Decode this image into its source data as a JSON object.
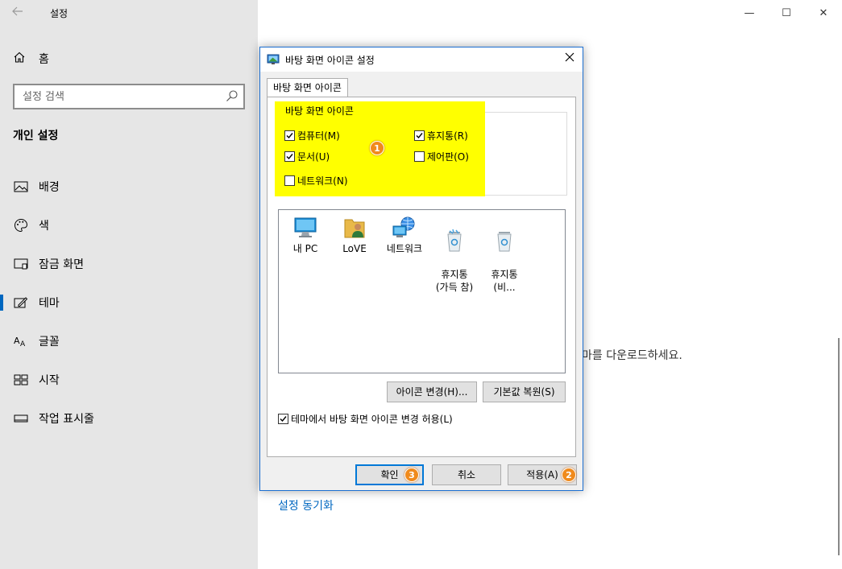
{
  "window": {
    "title": "설정",
    "controls": {
      "minimize": "—",
      "maximize": "☐",
      "close": "✕"
    }
  },
  "sidebar": {
    "home_label": "홈",
    "search_placeholder": "설정 검색",
    "section_title": "개인 설정",
    "items": [
      {
        "label": "배경",
        "icon": "image-icon"
      },
      {
        "label": "색",
        "icon": "palette-icon"
      },
      {
        "label": "잠금 화면",
        "icon": "lock-screen-icon"
      },
      {
        "label": "테마",
        "icon": "theme-icon",
        "active": true
      },
      {
        "label": "글꼴",
        "icon": "font-icon"
      },
      {
        "label": "시작",
        "icon": "start-icon"
      },
      {
        "label": "작업 표시줄",
        "icon": "taskbar-icon"
      }
    ]
  },
  "main": {
    "partial_text": "마를 다운로드하세요.",
    "sync_link": "설정 동기화"
  },
  "dialog": {
    "title": "바탕 화면 아이콘 설정",
    "tab_label": "바탕 화면 아이콘",
    "group_title": "바탕 화면 아이콘",
    "checkboxes": {
      "computer": {
        "label": "컴퓨터(M)",
        "checked": true
      },
      "recycle": {
        "label": "휴지통(R)",
        "checked": true
      },
      "documents": {
        "label": "문서(U)",
        "checked": true
      },
      "control_panel": {
        "label": "제어판(O)",
        "checked": false
      },
      "network": {
        "label": "네트워크(N)",
        "checked": false
      }
    },
    "icons": [
      {
        "label": "내 PC",
        "icon": "monitor-icon"
      },
      {
        "label": "LoVE",
        "icon": "user-folder-icon"
      },
      {
        "label": "네트워크",
        "icon": "network-icon"
      },
      {
        "label": "휴지통\n(가득 참)",
        "icon": "recycle-bin-full-icon"
      },
      {
        "label": "휴지통\n(비...",
        "icon": "recycle-bin-empty-icon"
      }
    ],
    "change_icon_button": "아이콘 변경(H)...",
    "restore_default_button": "기본값 복원(S)",
    "allow_theme_checkbox": {
      "label": "테마에서 바탕 화면 아이콘 변경 허용(L)",
      "checked": true
    },
    "ok_button": "확인",
    "cancel_button": "취소",
    "apply_button": "적용(A)",
    "badges": [
      "1",
      "2",
      "3"
    ],
    "highlight_color": "#ffff00",
    "badge_color": "#f08a1c"
  }
}
